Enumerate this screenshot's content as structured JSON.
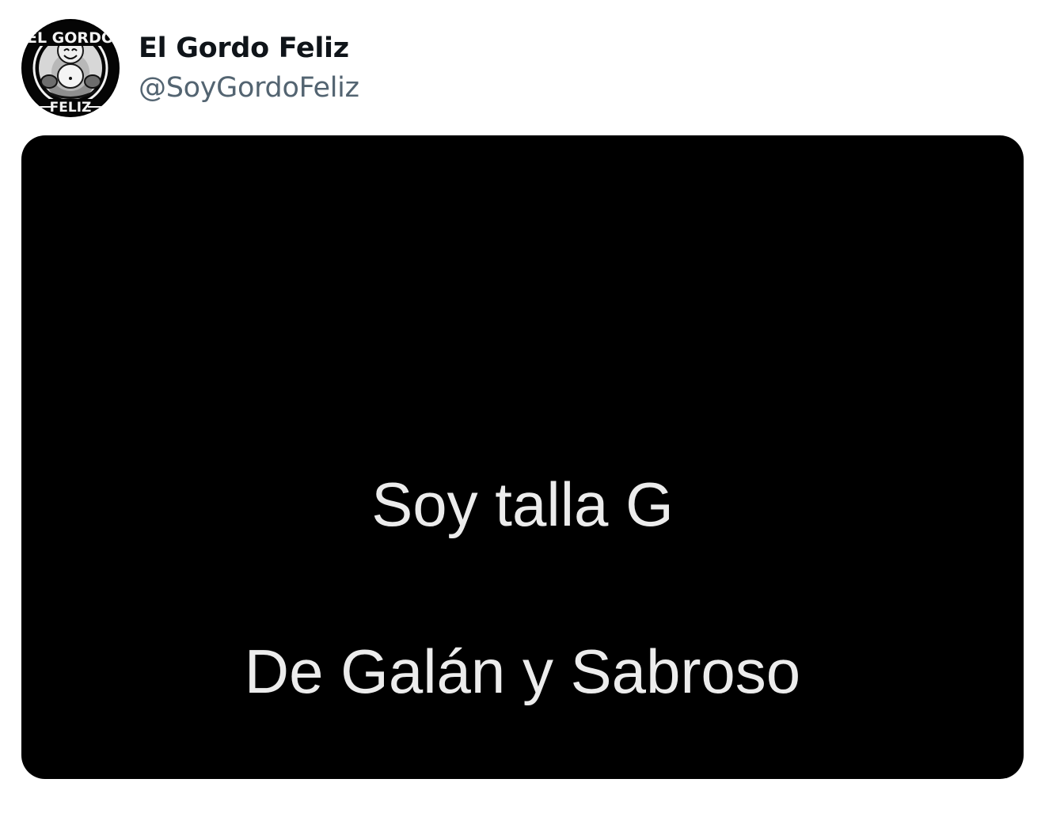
{
  "author": {
    "display_name": "El Gordo Feliz",
    "handle": "@SoyGordoFeliz",
    "avatar_icon": "laughing-buddha-logo-icon",
    "avatar_text_top": "EL GORDO",
    "avatar_text_bottom": "FELIZ"
  },
  "media": {
    "background": "#000000",
    "caption_lines": [
      "Soy talla G",
      "De Galán y Sabroso"
    ]
  }
}
